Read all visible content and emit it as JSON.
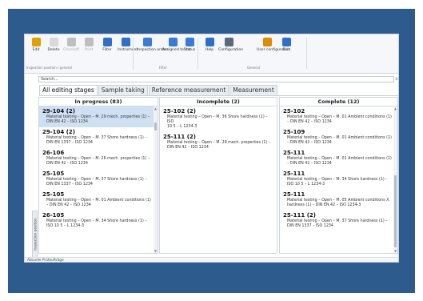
{
  "ribbon": {
    "buttons": [
      {
        "label": "Edit",
        "color": "#e0a000",
        "enabled": true
      },
      {
        "label": "Delete",
        "color": "#d9d9d9",
        "enabled": true
      },
      {
        "label": "Checkoff",
        "color": "#bfbfbf",
        "enabled": false
      },
      {
        "label": "Print",
        "color": "#bfbfbf",
        "enabled": false
      },
      {
        "label": "Filter",
        "color": "#2f6fc9",
        "enabled": true
      },
      {
        "label": "Instrument",
        "color": "#2f6fc9",
        "enabled": true
      },
      {
        "label": "Inspection orders",
        "color": "#3a7bd5",
        "enabled": true
      },
      {
        "label": "Assigned to me",
        "color": "#3a7bd5",
        "enabled": true
      },
      {
        "label": "Status",
        "color": "#3a7bd5",
        "enabled": true
      },
      {
        "label": "Help",
        "color": "#2f6fc9",
        "enabled": true
      },
      {
        "label": "Configuration",
        "color": "#5a6b80",
        "enabled": true
      },
      {
        "label": "User configuration",
        "color": "#e08a00",
        "enabled": true
      },
      {
        "label": "Exit",
        "color": "#2f6fc9",
        "enabled": true
      }
    ],
    "groups": [
      "Inspection position / general",
      "Filter",
      "General"
    ]
  },
  "search": {
    "placeholder": "Search..."
  },
  "tabs": [
    "All editing stages",
    "Sample taking",
    "Reference measurement",
    "Measurement"
  ],
  "side_tab": "Inspection position",
  "columns": [
    {
      "title": "In progress (83)",
      "cards": [
        {
          "id": "29-104 (2)",
          "desc": [
            "Material testing – Open – M. 29 mech. properties (1) –",
            "DIN EN 42 – ISO 1234"
          ],
          "selected": true
        },
        {
          "id": "29-104 (2)",
          "desc": [
            "Material testing – Open – M. 37 Shore hardness (1) –",
            "DIN EN 1337 – ISO 1234"
          ],
          "selected": false
        },
        {
          "id": "26-106",
          "desc": [
            "Material testing – Open – M. 26 mech. properties (1) –",
            "DIN EN 42 – ISO 1234"
          ],
          "selected": false
        },
        {
          "id": "25-105",
          "desc": [
            "Material testing – Open – M. 37 Shore hardness (1) –",
            "DIN EN 1337 – ISO 1234"
          ],
          "selected": false
        },
        {
          "id": "25-105",
          "desc": [
            "Material testing – Open – M. 01 Ambient conditions (1)",
            "– DIN EN 42 – ISO 1234"
          ],
          "selected": false
        },
        {
          "id": "26-105",
          "desc": [
            "Material testing – Open – M. 34 Shore hardness (1) –",
            "ISO 10 5 – L 1234-3"
          ],
          "selected": false
        }
      ]
    },
    {
      "title": "Incomplete (2)",
      "cards": [
        {
          "id": "25-102 (2)",
          "desc": [
            "Material testing – Open – M. 36 Shore hardness (1) – ISO",
            "10 5 – L 1234-3"
          ],
          "selected": false
        },
        {
          "id": "25-111 (2)",
          "desc": [
            "Material testing – Open – M. 29 mech. properties (1) –",
            "DIN EN 42 – ISO 1234"
          ],
          "selected": false
        }
      ]
    },
    {
      "title": "Complete (12)",
      "cards": [
        {
          "id": "25-102",
          "desc": [
            "Material testing – Open – M. 01 Ambient conditions (1)",
            "– DIN EN 42 – ISO 1234"
          ],
          "selected": false
        },
        {
          "id": "25-109",
          "desc": [
            "Material testing – Open – M. 01 Ambient conditions (1)",
            "– DIN EN 42 – ISO 1234"
          ],
          "selected": false
        },
        {
          "id": "25-111",
          "desc": [
            "Material testing – Open – M. 01 Ambient conditions (1)",
            "– DIN EN 42 – ISO 1234"
          ],
          "selected": false
        },
        {
          "id": "25-111",
          "desc": [
            "Material testing – Open – M. 34 Shore hardness (1) –",
            "ISO 10 5 – L 1234-3"
          ],
          "selected": false
        },
        {
          "id": "25-111",
          "desc": [
            "Material testing – Open – M. 05 Ambient conditions X.",
            "hardness (1) – DIN EN 42 – ISO 1234-3"
          ],
          "selected": false
        },
        {
          "id": "25-111 (2)",
          "desc": [
            "Material testing – Open – M. 37 Shore hardness (1) –",
            "DIN EN 1337 – ISO 1234"
          ],
          "selected": false
        }
      ]
    }
  ],
  "status_bar": "Aktuelle Prüfaufträge"
}
